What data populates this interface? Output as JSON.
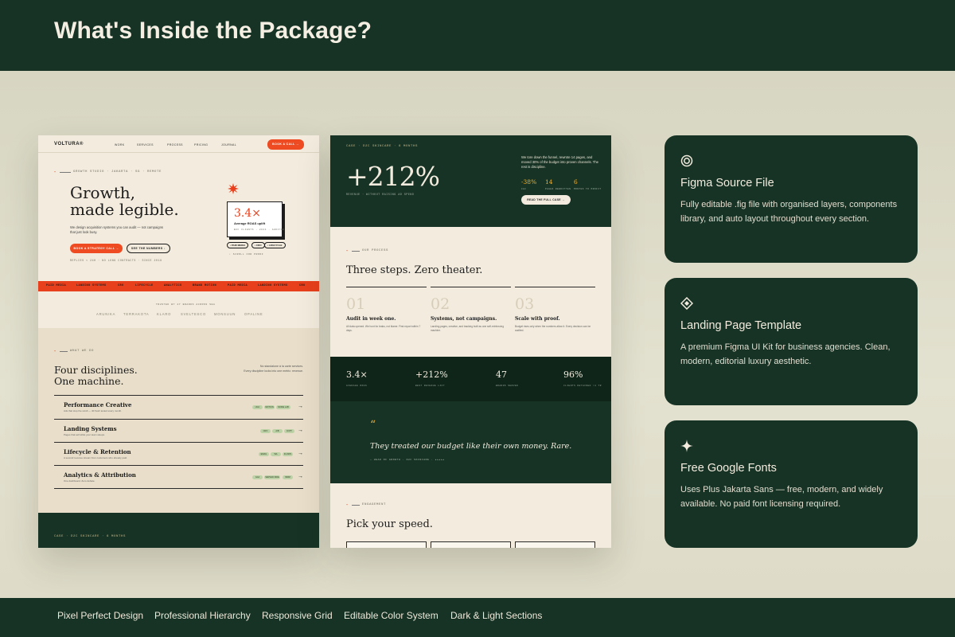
{
  "header": {
    "title": "What's Inside the Package?"
  },
  "mock_left": {
    "brand": "VOLTURA®",
    "nav": [
      "WORK",
      "SERVICES",
      "PROCESS",
      "PRICING",
      "JOURNAL"
    ],
    "nav_cta": "BOOK A CALL →",
    "eyebrow": "GROWTH STUDIO · JAKARTA · SG · REMOTE",
    "hero_title_1": "Growth,",
    "hero_title_2": "made legible.",
    "hero_desc": "We design acquisition systems you can audit — not campaigns that just look busy.",
    "btn_primary": "BOOK A STRATEGY CALL →",
    "btn_secondary": "SEE THE NUMBERS ↓",
    "hero_meta": "REPLIES < 24H · NO LONG CONTRACTS · SINCE 2019",
    "roas_value": "3.4×",
    "roas_label": "Average ROAS uplift",
    "roas_meta": "B2C CLIENTS · 2024 · AUDITED",
    "chips": [
      "• PAID MEDIA",
      "• CRO",
      "• LIFECYCLE"
    ],
    "scroll_hint": "↓ SCROLL FOR PROOF",
    "ticker": [
      "PAID MEDIA",
      "LANDING SYSTEMS",
      "CRO",
      "LIFECYCLE",
      "ANALYTICS",
      "BRAND MOTION",
      "PAID MEDIA",
      "LANDING SYSTEMS",
      "CRO"
    ],
    "trusted_label": "TRUSTED BY 47 BRANDS ACROSS SEA",
    "logos": [
      "ARUNIKA",
      "TERRAKOTA",
      "KLARO",
      "SVELTESCO",
      "MONSUUN",
      "OPALINE"
    ],
    "disc_eyebrow": "WHAT WE DO",
    "disc_title_1": "Four disciplines.",
    "disc_title_2": "One machine.",
    "disc_aside_1": "No standalone à la carte services.",
    "disc_aside_2": "Every discipline locks into one metric: revenue.",
    "disciplines": [
      {
        "name": "Performance Creative",
        "sub": "Ads that stop the scroll — 40 fresh tested every month.",
        "tags": [
          "UGC",
          "MOTION",
          "MODE LAB"
        ]
      },
      {
        "name": "Landing Systems",
        "sub": "Pages that sell while your team sleeps.",
        "tags": [
          "CRO",
          "A/B",
          "COPY"
        ]
      },
      {
        "name": "Lifecycle & Retention",
        "sub": "A second revenue stream from customers who already paid.",
        "tags": [
          "EMAIL",
          "WA",
          "FLOWS"
        ]
      },
      {
        "name": "Analytics & Attribution",
        "sub": "One dashboard. Zero debate.",
        "tags": [
          "GA4",
          "SERVER-SIDE",
          "MMM"
        ]
      }
    ],
    "bottom_eyebrow": "CASE · D2C SKINCARE · 6 MONTHS"
  },
  "mock_right": {
    "eyebrow": "CASE · D2C SKINCARE · 6 MONTHS",
    "big_value": "+212%",
    "big_label": "REVENUE · WITHOUT RAISING AD SPEND",
    "case_text": "We tore down the funnel, rewrote 14 pages, and moved 30% of the budget into proven channels. The rest is discipline.",
    "stats": [
      {
        "value": "-38%",
        "label": "CAC"
      },
      {
        "value": "14",
        "label": "PAGES REWRITTEN"
      },
      {
        "value": "6",
        "label": "MONTHS TO PROFIT"
      }
    ],
    "case_cta": "READ THE FULL CASE →",
    "process_eyebrow": "OUR PROCESS",
    "process_title": "Three steps. Zero theater.",
    "steps": [
      {
        "num": "01",
        "title": "Audit in week one.",
        "desc": "All data opened. We hunt for leaks, not blame. First report within 7 days."
      },
      {
        "num": "02",
        "title": "Systems, not campaigns.",
        "desc": "Landing pages, creative, and tracking built as one self-reinforcing machine."
      },
      {
        "num": "03",
        "title": "Scale with proof.",
        "desc": "Budget rises only when the numbers allow it. Every decision can be audited."
      }
    ],
    "bar_stats": [
      {
        "value": "3.4×",
        "label": "AVERAGE ROAS"
      },
      {
        "value": "+212%",
        "label": "BEST REVENUE LIFT"
      },
      {
        "value": "47",
        "label": "BRANDS SERVED"
      },
      {
        "value": "96%",
        "label": "CLIENTS RETAINED >1 YR"
      }
    ],
    "quote_mark": "“",
    "quote": "They treated our budget like their own money. Rare.",
    "quote_author": "— HEAD OF GROWTH · D2C SKINCARE · ★★★★★",
    "speed_eyebrow": "ENGAGEMENT",
    "speed_title": "Pick your speed."
  },
  "features": [
    {
      "icon": "ring-icon",
      "title": "Figma Source File",
      "desc": "Fully editable .fig file with organised layers, components library, and auto layout throughout every section."
    },
    {
      "icon": "diamond-icon",
      "title": "Landing Page Template",
      "desc": "A premium Figma UI Kit for business agencies. Clean, modern, editorial luxury aesthetic."
    },
    {
      "icon": "sparkle-icon",
      "title": "Free Google Fonts",
      "desc": "Uses Plus Jakarta Sans — free, modern, and widely available. No paid font licensing required."
    }
  ],
  "footer": [
    "Pixel Perfect Design",
    "Professional Hierarchy",
    "Responsive Grid",
    "Editable Color System",
    "Dark & Light Sections"
  ],
  "colors": {
    "dark_green": "#163325",
    "accent_orange": "#e8401c",
    "cream": "#f3ecde",
    "gold": "#f2b233",
    "stage": "#dcdac8"
  }
}
